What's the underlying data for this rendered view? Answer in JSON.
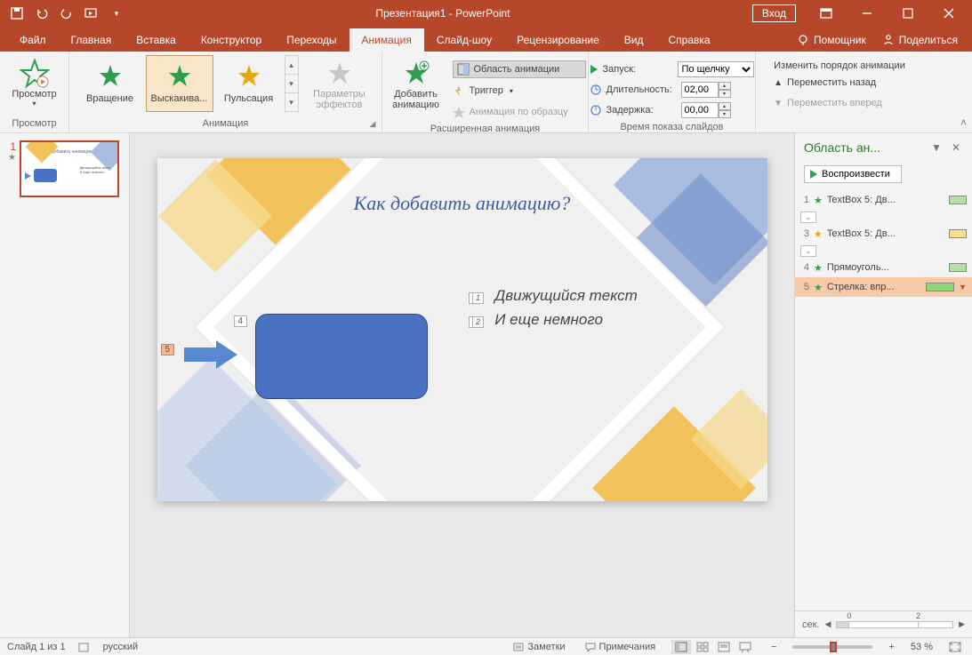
{
  "titlebar": {
    "doc_title": "Презентация1 - PowerPoint",
    "login": "Вход"
  },
  "tabs": {
    "file": "Файл",
    "home": "Главная",
    "insert": "Вставка",
    "design": "Конструктор",
    "transitions": "Переходы",
    "animations": "Анимация",
    "slideshow": "Слайд-шоу",
    "review": "Рецензирование",
    "view": "Вид",
    "help": "Справка",
    "assistant": "Помощник",
    "share": "Поделиться"
  },
  "ribbon": {
    "preview_group": "Просмотр",
    "preview_btn": "Просмотр",
    "animation_group": "Анимация",
    "gallery": {
      "g1": "Вращение",
      "g2": "Выскакива...",
      "g3": "Пульсация"
    },
    "effect_options": "Параметры\nэффектов",
    "adv_group": "Расширенная анимация",
    "add_animation": "Добавить\nанимацию",
    "anim_pane": "Область анимации",
    "trigger": "Триггер",
    "anim_painter": "Анимация по образцу",
    "timing_group": "Время показа слайдов",
    "start_label": "Запуск:",
    "start_value": "По щелчку",
    "duration_label": "Длительность:",
    "duration_value": "02,00",
    "delay_label": "Задержка:",
    "delay_value": "00,00",
    "reorder_title": "Изменить порядок анимации",
    "move_earlier": "Переместить назад",
    "move_later": "Переместить вперед"
  },
  "thumb": {
    "num": "1",
    "title": "Как добавить анимацию?"
  },
  "slide": {
    "title": "Как добавить анимацию?",
    "tag4": "4",
    "tag5": "5",
    "tag1": "1",
    "tag2": "2",
    "line1": "Движущийся текст",
    "line2": "И еще немного"
  },
  "pane": {
    "title": "Область ан...",
    "play": "Воспроизвести",
    "items": [
      {
        "n": "1",
        "star": "green",
        "label": "TextBox 5: Дв...",
        "bar": "#b5e0a5"
      },
      {
        "n": "3",
        "star": "yellow",
        "label": "TextBox 5: Дв...",
        "bar": "#f8e08a"
      },
      {
        "n": "4",
        "star": "green",
        "label": "Прямоуголь...",
        "bar": "#b5e0a5"
      },
      {
        "n": "5",
        "star": "green",
        "label": "Стрелка: впр...",
        "bar": "#8fd47a",
        "sel": true
      }
    ],
    "sec_label": "сек.",
    "t0": "0",
    "t2": "2"
  },
  "status": {
    "slide_pos": "Слайд 1 из 1",
    "lang": "русский",
    "notes": "Заметки",
    "comments": "Примечания",
    "zoom": "53 %"
  }
}
